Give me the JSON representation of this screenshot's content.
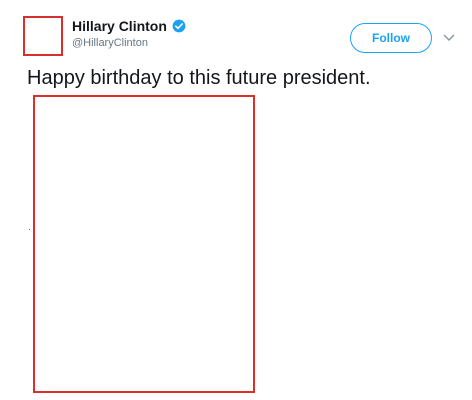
{
  "author": {
    "display_name": "Hillary Clinton",
    "handle": "@HillaryClinton",
    "verified": true,
    "avatar": "avatar-placeholder"
  },
  "actions": {
    "follow_label": "Follow",
    "more_icon": "chevron-down-icon"
  },
  "tweet": {
    "text": "Happy birthday to this future president.",
    "media": "image-placeholder"
  },
  "colors": {
    "accent": "#1da1f2",
    "placeholder_border": "#d9302d",
    "text_primary": "#14171a",
    "text_secondary": "#657786"
  }
}
